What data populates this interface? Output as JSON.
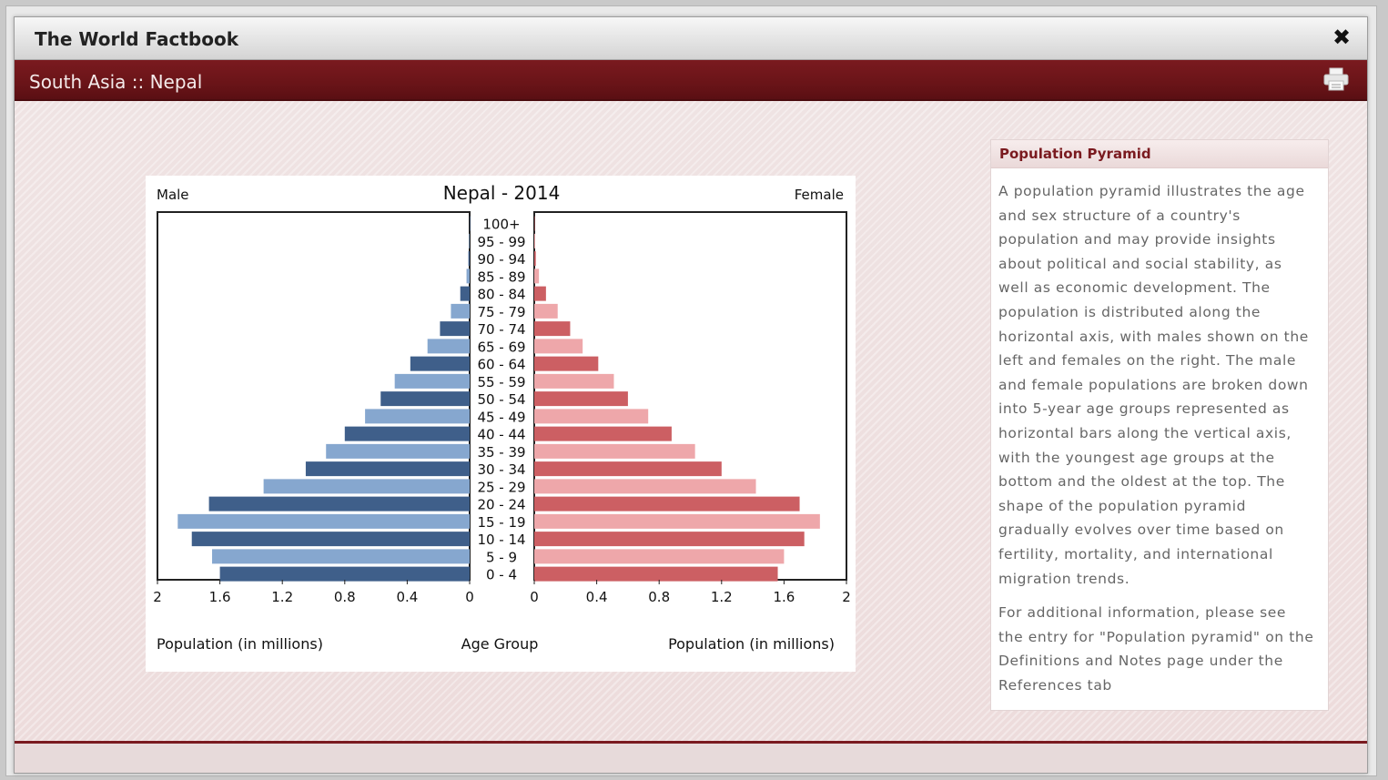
{
  "window": {
    "title": "The World Factbook",
    "close_icon": "close-icon",
    "breadcrumb": "South Asia :: Nepal",
    "print_icon": "printer-icon"
  },
  "colors": {
    "header_red": "#6a1418",
    "male_dark": "#3f5f8a",
    "male_light": "#86a7cf",
    "female_dark": "#cc5f63",
    "female_light": "#eea7aa"
  },
  "side_panel": {
    "heading": "Population Pyramid",
    "paragraph1": "A population pyramid illustrates the age and sex structure of a country's population and may provide insights about political and social stability, as well as economic development. The population is distributed along the horizontal axis, with males shown on the left and females on the right. The male and female populations are broken down into 5-year age groups represented as horizontal bars along the vertical axis, with the youngest age groups at the bottom and the oldest at the top. The shape of the population pyramid gradually evolves over time based on fertility, mortality, and international migration trends.",
    "paragraph2": "For additional information, please see the entry for \"Population pyramid\" on the Definitions and Notes page under the References tab"
  },
  "chart_data": {
    "type": "bar",
    "title": "Nepal - 2014",
    "left_label": "Male",
    "right_label": "Female",
    "xlabel_left": "Population (in millions)",
    "xlabel_center": "Age Group",
    "xlabel_right": "Population (in millions)",
    "xlim": [
      0,
      2
    ],
    "x_ticks_left": [
      "2",
      "1.6",
      "1.2",
      "0.8",
      "0.4",
      "0"
    ],
    "x_ticks_right": [
      "0",
      "0.4",
      "0.8",
      "1.2",
      "1.6",
      "2"
    ],
    "categories": [
      "100+",
      "95 - 99",
      "90 - 94",
      "85 - 89",
      "80 - 84",
      "75 - 79",
      "70 - 74",
      "65 - 69",
      "60 - 64",
      "55 - 59",
      "50 - 54",
      "45 - 49",
      "40 - 44",
      "35 - 39",
      "30 - 34",
      "25 - 29",
      "20 - 24",
      "15 - 19",
      "10 - 14",
      "5 - 9",
      "0 - 4"
    ],
    "series": [
      {
        "name": "Male",
        "values": [
          0.0,
          0.004,
          0.008,
          0.02,
          0.06,
          0.12,
          0.19,
          0.27,
          0.38,
          0.48,
          0.57,
          0.67,
          0.8,
          0.92,
          1.05,
          1.32,
          1.67,
          1.87,
          1.78,
          1.65,
          1.6
        ]
      },
      {
        "name": "Female",
        "values": [
          0.002,
          0.006,
          0.01,
          0.03,
          0.075,
          0.15,
          0.23,
          0.31,
          0.41,
          0.51,
          0.6,
          0.73,
          0.88,
          1.03,
          1.2,
          1.42,
          1.7,
          1.83,
          1.73,
          1.6,
          1.56
        ]
      }
    ],
    "grid": false,
    "legend": "none"
  }
}
